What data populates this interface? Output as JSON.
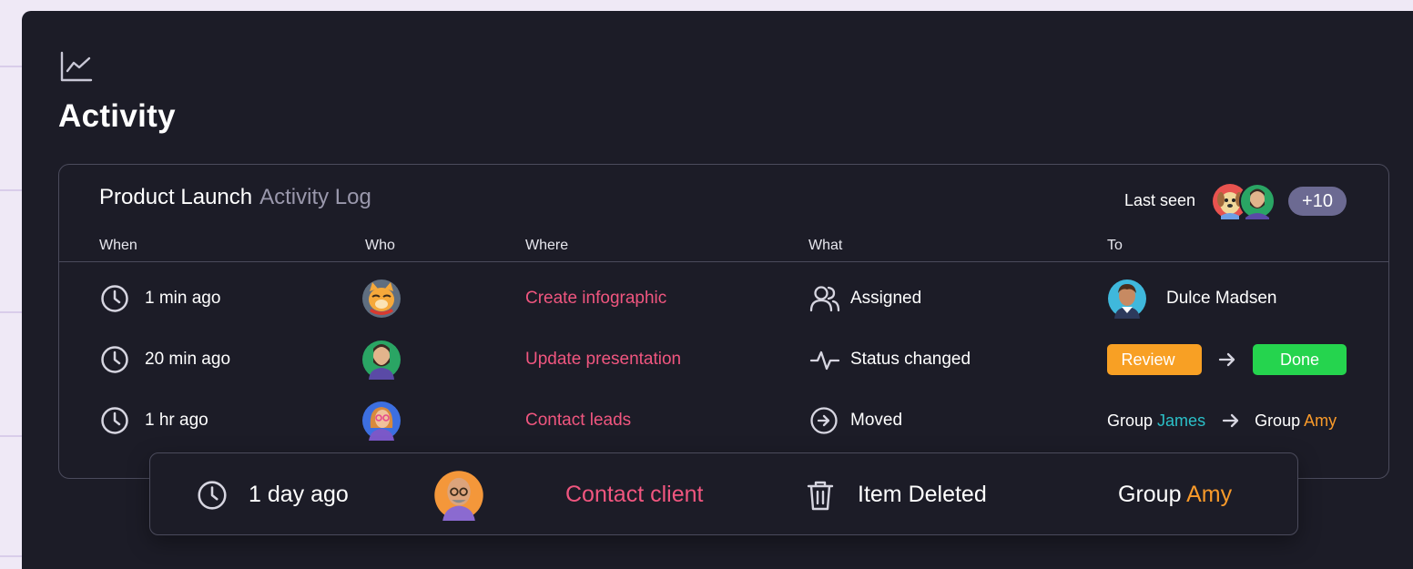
{
  "page": {
    "title": "Activity",
    "title_icon": "line-chart-icon"
  },
  "log": {
    "project": "Product Launch",
    "label": "Activity Log",
    "last_seen_label": "Last seen",
    "last_seen_more": "+10",
    "columns": {
      "when": "When",
      "who": "Who",
      "where": "Where",
      "what": "What",
      "to": "To"
    },
    "rows": [
      {
        "when": "1 min ago",
        "who_avatar": "cat-avatar",
        "where": "Create infographic",
        "what_icon": "users-icon",
        "what": "Assigned",
        "to_name": "Dulce Madsen"
      },
      {
        "when": "20 min ago",
        "who_avatar": "bearded-man-avatar",
        "where": "Update presentation",
        "what_icon": "activity-pulse-icon",
        "what": "Status changed",
        "status_from": "Review",
        "status_to": "Done"
      },
      {
        "when": "1 hr ago",
        "who_avatar": "woman-avatar",
        "where": "Contact leads",
        "what_icon": "arrow-circle-right-icon",
        "what": "Moved",
        "group_word": "Group",
        "group_from": "James",
        "group_to": "Amy"
      }
    ],
    "dragging_row": {
      "when": "1 day ago",
      "who_avatar": "bald-man-avatar",
      "where": "Contact client",
      "what_icon": "trash-icon",
      "what": "Item Deleted",
      "group_word": "Group",
      "group": "Amy"
    }
  },
  "colors": {
    "accent_pink": "#f0567f",
    "review": "#f8a024",
    "done": "#25d44e",
    "teal": "#2bc0c8",
    "orange": "#f99a2a",
    "badge": "#6c6a92"
  }
}
